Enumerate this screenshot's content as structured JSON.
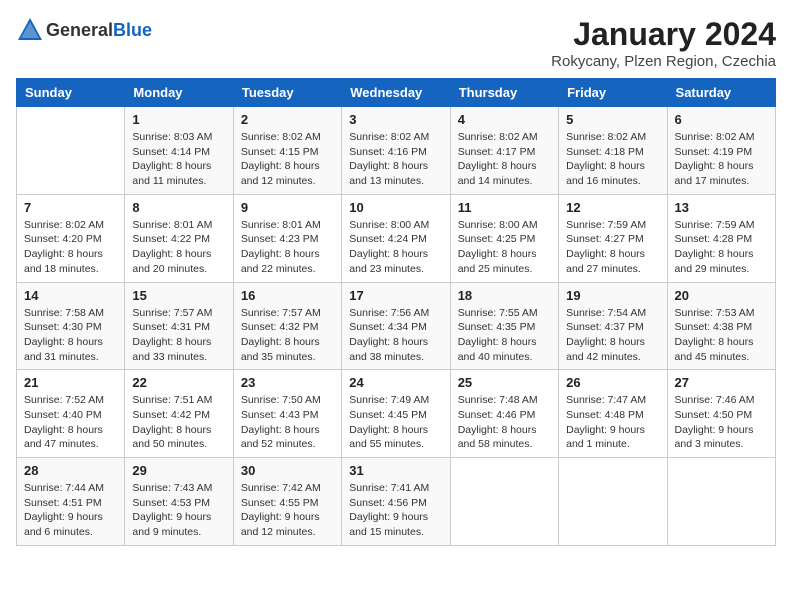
{
  "header": {
    "logo_general": "General",
    "logo_blue": "Blue",
    "title": "January 2024",
    "subtitle": "Rokycany, Plzen Region, Czechia"
  },
  "calendar": {
    "days_of_week": [
      "Sunday",
      "Monday",
      "Tuesday",
      "Wednesday",
      "Thursday",
      "Friday",
      "Saturday"
    ],
    "weeks": [
      [
        {
          "day": "",
          "info": ""
        },
        {
          "day": "1",
          "info": "Sunrise: 8:03 AM\nSunset: 4:14 PM\nDaylight: 8 hours\nand 11 minutes."
        },
        {
          "day": "2",
          "info": "Sunrise: 8:02 AM\nSunset: 4:15 PM\nDaylight: 8 hours\nand 12 minutes."
        },
        {
          "day": "3",
          "info": "Sunrise: 8:02 AM\nSunset: 4:16 PM\nDaylight: 8 hours\nand 13 minutes."
        },
        {
          "day": "4",
          "info": "Sunrise: 8:02 AM\nSunset: 4:17 PM\nDaylight: 8 hours\nand 14 minutes."
        },
        {
          "day": "5",
          "info": "Sunrise: 8:02 AM\nSunset: 4:18 PM\nDaylight: 8 hours\nand 16 minutes."
        },
        {
          "day": "6",
          "info": "Sunrise: 8:02 AM\nSunset: 4:19 PM\nDaylight: 8 hours\nand 17 minutes."
        }
      ],
      [
        {
          "day": "7",
          "info": "Sunrise: 8:02 AM\nSunset: 4:20 PM\nDaylight: 8 hours\nand 18 minutes."
        },
        {
          "day": "8",
          "info": "Sunrise: 8:01 AM\nSunset: 4:22 PM\nDaylight: 8 hours\nand 20 minutes."
        },
        {
          "day": "9",
          "info": "Sunrise: 8:01 AM\nSunset: 4:23 PM\nDaylight: 8 hours\nand 22 minutes."
        },
        {
          "day": "10",
          "info": "Sunrise: 8:00 AM\nSunset: 4:24 PM\nDaylight: 8 hours\nand 23 minutes."
        },
        {
          "day": "11",
          "info": "Sunrise: 8:00 AM\nSunset: 4:25 PM\nDaylight: 8 hours\nand 25 minutes."
        },
        {
          "day": "12",
          "info": "Sunrise: 7:59 AM\nSunset: 4:27 PM\nDaylight: 8 hours\nand 27 minutes."
        },
        {
          "day": "13",
          "info": "Sunrise: 7:59 AM\nSunset: 4:28 PM\nDaylight: 8 hours\nand 29 minutes."
        }
      ],
      [
        {
          "day": "14",
          "info": "Sunrise: 7:58 AM\nSunset: 4:30 PM\nDaylight: 8 hours\nand 31 minutes."
        },
        {
          "day": "15",
          "info": "Sunrise: 7:57 AM\nSunset: 4:31 PM\nDaylight: 8 hours\nand 33 minutes."
        },
        {
          "day": "16",
          "info": "Sunrise: 7:57 AM\nSunset: 4:32 PM\nDaylight: 8 hours\nand 35 minutes."
        },
        {
          "day": "17",
          "info": "Sunrise: 7:56 AM\nSunset: 4:34 PM\nDaylight: 8 hours\nand 38 minutes."
        },
        {
          "day": "18",
          "info": "Sunrise: 7:55 AM\nSunset: 4:35 PM\nDaylight: 8 hours\nand 40 minutes."
        },
        {
          "day": "19",
          "info": "Sunrise: 7:54 AM\nSunset: 4:37 PM\nDaylight: 8 hours\nand 42 minutes."
        },
        {
          "day": "20",
          "info": "Sunrise: 7:53 AM\nSunset: 4:38 PM\nDaylight: 8 hours\nand 45 minutes."
        }
      ],
      [
        {
          "day": "21",
          "info": "Sunrise: 7:52 AM\nSunset: 4:40 PM\nDaylight: 8 hours\nand 47 minutes."
        },
        {
          "day": "22",
          "info": "Sunrise: 7:51 AM\nSunset: 4:42 PM\nDaylight: 8 hours\nand 50 minutes."
        },
        {
          "day": "23",
          "info": "Sunrise: 7:50 AM\nSunset: 4:43 PM\nDaylight: 8 hours\nand 52 minutes."
        },
        {
          "day": "24",
          "info": "Sunrise: 7:49 AM\nSunset: 4:45 PM\nDaylight: 8 hours\nand 55 minutes."
        },
        {
          "day": "25",
          "info": "Sunrise: 7:48 AM\nSunset: 4:46 PM\nDaylight: 8 hours\nand 58 minutes."
        },
        {
          "day": "26",
          "info": "Sunrise: 7:47 AM\nSunset: 4:48 PM\nDaylight: 9 hours\nand 1 minute."
        },
        {
          "day": "27",
          "info": "Sunrise: 7:46 AM\nSunset: 4:50 PM\nDaylight: 9 hours\nand 3 minutes."
        }
      ],
      [
        {
          "day": "28",
          "info": "Sunrise: 7:44 AM\nSunset: 4:51 PM\nDaylight: 9 hours\nand 6 minutes."
        },
        {
          "day": "29",
          "info": "Sunrise: 7:43 AM\nSunset: 4:53 PM\nDaylight: 9 hours\nand 9 minutes."
        },
        {
          "day": "30",
          "info": "Sunrise: 7:42 AM\nSunset: 4:55 PM\nDaylight: 9 hours\nand 12 minutes."
        },
        {
          "day": "31",
          "info": "Sunrise: 7:41 AM\nSunset: 4:56 PM\nDaylight: 9 hours\nand 15 minutes."
        },
        {
          "day": "",
          "info": ""
        },
        {
          "day": "",
          "info": ""
        },
        {
          "day": "",
          "info": ""
        }
      ]
    ]
  }
}
